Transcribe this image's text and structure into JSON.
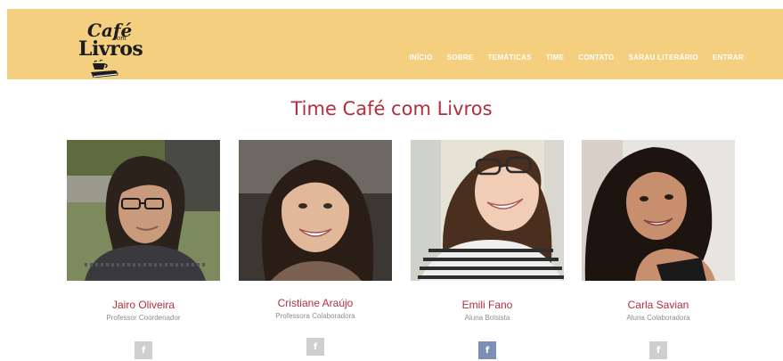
{
  "brand": {
    "line1": "Café",
    "line2": "com",
    "line3": "Livros"
  },
  "nav": {
    "items": [
      "INÍCIO",
      "SOBRE",
      "TEMÁTICAS",
      "TIME",
      "CONTATO",
      "SARAU LITERÁRIO",
      "ENTRAR"
    ]
  },
  "page": {
    "title": "Time Café com Livros"
  },
  "team": [
    {
      "name": "Jairo Oliveira",
      "role": "Professor Coordenador",
      "social_icon": "f"
    },
    {
      "name": "Cristiane Araújo",
      "role": "Professora Colaboradora",
      "social_icon": "f"
    },
    {
      "name": "Emili Fano",
      "role": "Aluna Bolsista",
      "social_icon": "f"
    },
    {
      "name": "Carla Savian",
      "role": "Aluna Colaboradora",
      "social_icon": "f"
    }
  ],
  "colors": {
    "header_bg": "#f3cf7f",
    "accent": "#b0303e",
    "facebook_active": "#7b8fb7"
  }
}
